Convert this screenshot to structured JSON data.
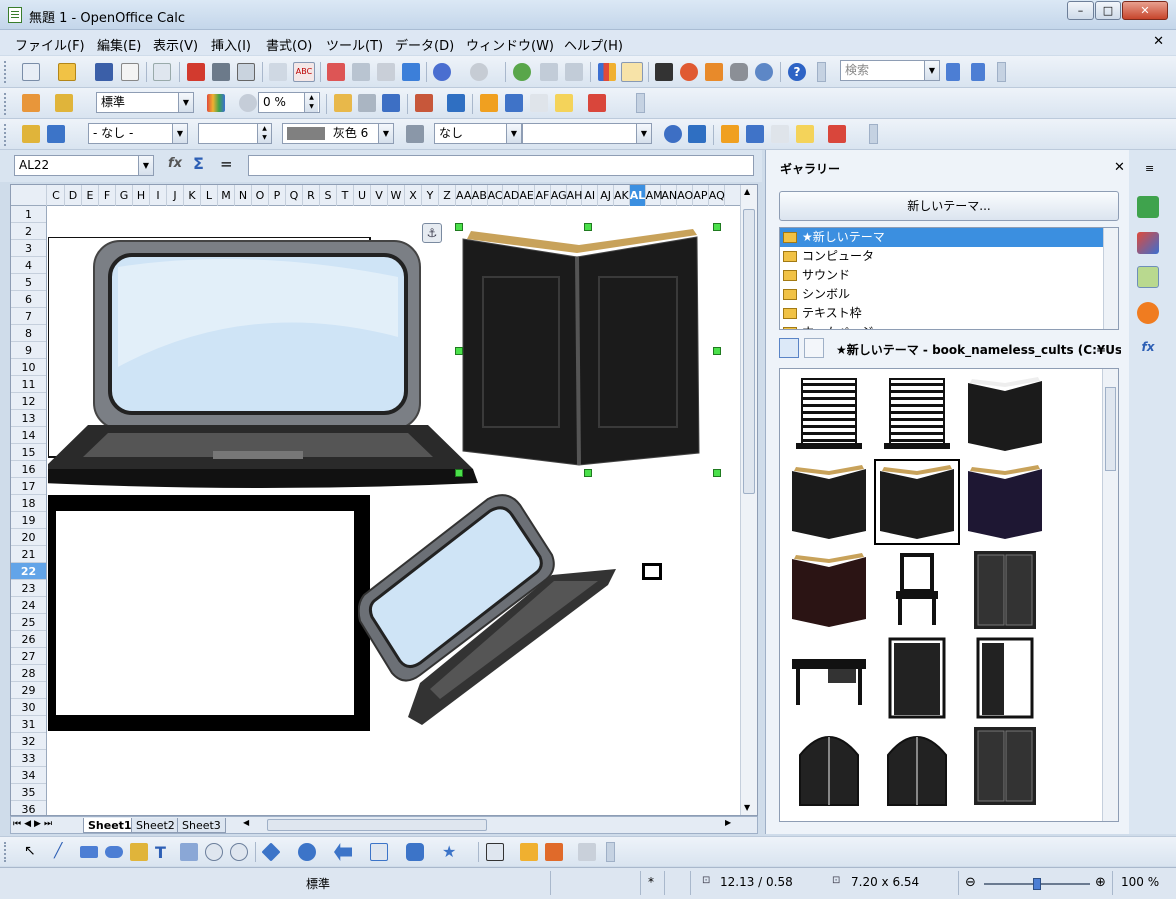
{
  "window": {
    "title": "無題 1 - OpenOffice Calc",
    "buttons": {
      "minimize": "–",
      "maximize": "□",
      "close": "✕"
    }
  },
  "menu": {
    "items": [
      {
        "label": "ファイル(F)"
      },
      {
        "label": "編集(E)"
      },
      {
        "label": "表示(V)"
      },
      {
        "label": "挿入(I)"
      },
      {
        "label": "書式(O)"
      },
      {
        "label": "ツール(T)"
      },
      {
        "label": "データ(D)"
      },
      {
        "label": "ウィンドウ(W)"
      },
      {
        "label": "ヘルプ(H)"
      }
    ],
    "close": "✕"
  },
  "toolbar1": {
    "search_placeholder": "検索"
  },
  "toolbar2": {
    "style_value": "標準",
    "transparency_value": "0 %"
  },
  "toolbar3": {
    "line_style_value": "- なし -",
    "line_width_value": "",
    "color_name": "灰色 6",
    "area_style_value": "なし",
    "area_fill_value": ""
  },
  "formula": {
    "namebox": "AL22",
    "input_value": "",
    "equals": "="
  },
  "sheet": {
    "columns": [
      "C",
      "D",
      "E",
      "F",
      "G",
      "H",
      "I",
      "J",
      "K",
      "L",
      "M",
      "N",
      "O",
      "P",
      "Q",
      "R",
      "S",
      "T",
      "U",
      "V",
      "W",
      "X",
      "Y",
      "Z",
      "AA",
      "AB",
      "AC",
      "AD",
      "AE",
      "AF",
      "AG",
      "AH",
      "AI",
      "AJ",
      "AK",
      "AL",
      "AM",
      "AN",
      "AO",
      "AP",
      "AQ"
    ],
    "active_column": "AL",
    "rows": [
      "1",
      "2",
      "3",
      "4",
      "5",
      "6",
      "7",
      "8",
      "9",
      "10",
      "11",
      "12",
      "13",
      "14",
      "15",
      "16",
      "17",
      "18",
      "19",
      "20",
      "21",
      "22",
      "23",
      "24",
      "25",
      "26",
      "27",
      "28",
      "29",
      "30",
      "31",
      "32",
      "33",
      "34",
      "35",
      "36"
    ],
    "active_row": "22",
    "tabs": [
      "Sheet1",
      "Sheet2",
      "Sheet3"
    ],
    "active_tab": "Sheet1"
  },
  "gallery": {
    "title": "ギャラリー",
    "new_theme_button": "新しいテーマ...",
    "themes": [
      {
        "label": "★新しいテーマ",
        "selected": true
      },
      {
        "label": "コンピュータ",
        "selected": false
      },
      {
        "label": "サウンド",
        "selected": false
      },
      {
        "label": "シンボル",
        "selected": false
      },
      {
        "label": "テキスト枠",
        "selected": false
      },
      {
        "label": "ホームページ",
        "selected": false
      }
    ],
    "current_path": "★新しいテーマ - book_nameless_cults (C:¥Us",
    "close": "✕"
  },
  "status": {
    "page_style": "標準",
    "modified": "*",
    "position": "12.13 / 0.58",
    "size": "7.20 x 6.54",
    "zoom": "100 %",
    "zoom_level": 0.5
  },
  "colors": {
    "accent": "#3b8fe0",
    "selection_handle": "#4be04b",
    "titlebar": "#c4d6ea"
  }
}
